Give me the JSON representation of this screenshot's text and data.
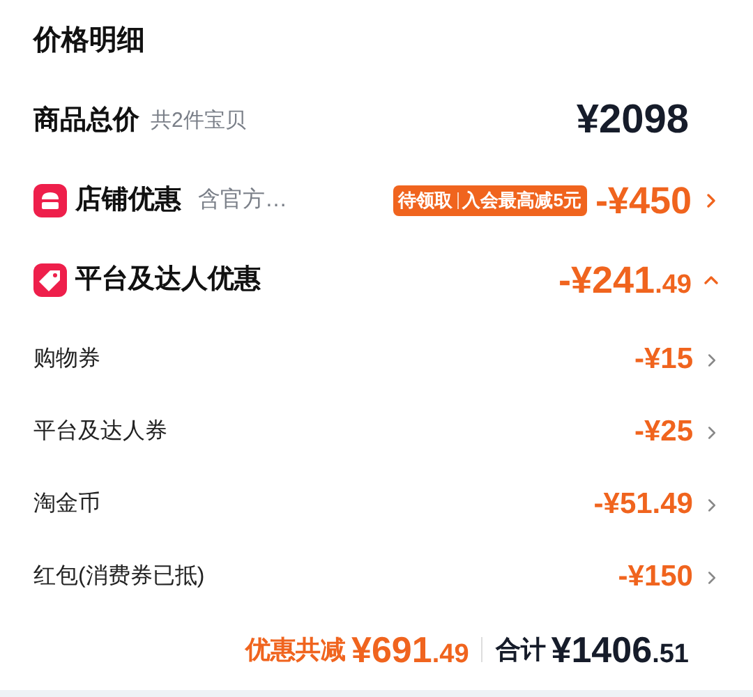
{
  "title": "价格明细",
  "subtotal": {
    "label": "商品总价",
    "note": "共2件宝贝",
    "amount": "¥2098"
  },
  "sections": [
    {
      "kind": "store",
      "label": "店铺优惠",
      "note": "含官方…",
      "badge": [
        "待领取",
        "入会最高减5元"
      ],
      "amount": "-¥450",
      "expanded": false
    },
    {
      "kind": "tag",
      "label": "平台及达人优惠",
      "amount": "-¥241.49",
      "expanded": true
    }
  ],
  "items": [
    {
      "label": "购物券",
      "amount": "-¥15"
    },
    {
      "label": "平台及达人券",
      "amount": "-¥25"
    },
    {
      "label": "淘金币",
      "amount": "-¥51.49"
    },
    {
      "label": "红包(消费券已抵)",
      "amount": "-¥150"
    }
  ],
  "footer": {
    "discount_label": "优惠共减",
    "discount": "¥691.49",
    "total_label": "合计",
    "total": "¥1406.51"
  }
}
